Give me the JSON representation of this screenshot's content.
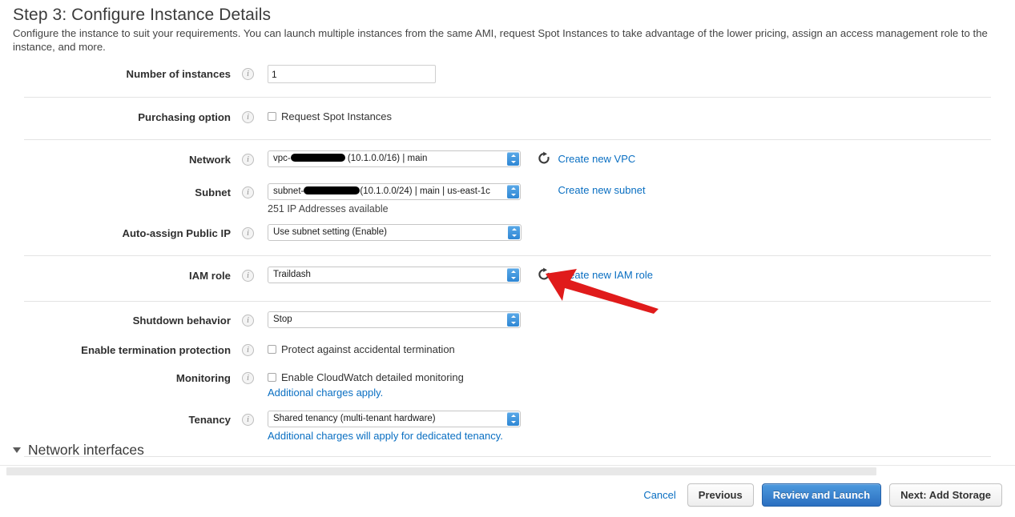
{
  "header": {
    "title": "Step 3: Configure Instance Details",
    "description": "Configure the instance to suit your requirements. You can launch multiple instances from the same AMI, request Spot Instances to take advantage of the lower pricing, assign an access management role to the instance, and more."
  },
  "fields": {
    "number_of_instances": {
      "label": "Number of instances",
      "value": "1",
      "info": "i"
    },
    "purchasing_option": {
      "label": "Purchasing option",
      "checkbox_label": "Request Spot Instances",
      "checked": false
    },
    "network": {
      "label": "Network",
      "value_prefix": "vpc-",
      "value_suffix": " (10.1.0.0/16) | main",
      "redacted": true,
      "link": "Create new VPC",
      "refresh_icon": "refresh-icon"
    },
    "subnet": {
      "label": "Subnet",
      "value_prefix": "subnet-",
      "value_suffix": "(10.1.0.0/24) | main | us-east-1c",
      "redacted": true,
      "helper": "251 IP Addresses available",
      "link": "Create new subnet"
    },
    "auto_assign_public_ip": {
      "label": "Auto-assign Public IP",
      "value": "Use subnet setting (Enable)"
    },
    "iam_role": {
      "label": "IAM role",
      "value": "Traildash",
      "link": "Create new IAM role",
      "refresh_icon": "refresh-icon"
    },
    "shutdown_behavior": {
      "label": "Shutdown behavior",
      "value": "Stop"
    },
    "termination_protection": {
      "label": "Enable termination protection",
      "checkbox_label": "Protect against accidental termination",
      "checked": false
    },
    "monitoring": {
      "label": "Monitoring",
      "checkbox_label": "Enable CloudWatch detailed monitoring",
      "checked": false,
      "note": "Additional charges apply."
    },
    "tenancy": {
      "label": "Tenancy",
      "value": "Shared tenancy (multi-tenant hardware)",
      "note": "Additional charges will apply for dedicated tenancy."
    }
  },
  "network_interfaces": {
    "title": "Network interfaces",
    "expanded": true,
    "disclosure_icon": "caret-down-icon"
  },
  "footer": {
    "cancel": "Cancel",
    "previous": "Previous",
    "review_and_launch": "Review and Launch",
    "next": "Next: Add Storage"
  },
  "annotation": {
    "arrow_color": "#e01b1b",
    "points_at": "iam-role-select"
  },
  "colors": {
    "link": "#0a6fc2",
    "primary_button": "#2b6fc0",
    "annotation": "#e01b1b"
  }
}
